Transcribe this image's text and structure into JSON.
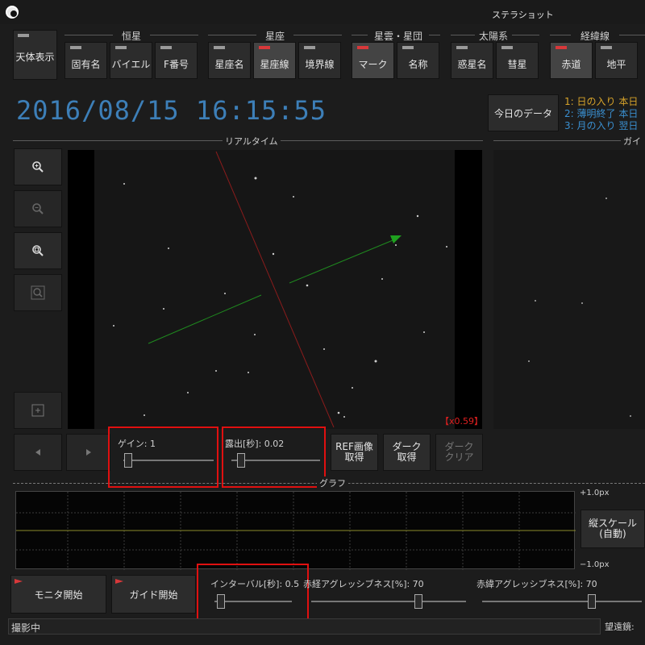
{
  "app": {
    "title": "ステラショット"
  },
  "toolbar": {
    "celestial_display": "天体表示",
    "groups": [
      {
        "label": "恒星",
        "buttons": [
          {
            "label": "固有名",
            "on": false
          },
          {
            "label": "バイエル",
            "on": false
          },
          {
            "label": "F番号",
            "on": false
          }
        ]
      },
      {
        "label": "星座",
        "buttons": [
          {
            "label": "星座名",
            "on": false
          },
          {
            "label": "星座線",
            "on": true
          },
          {
            "label": "境界線",
            "on": false
          }
        ]
      },
      {
        "label": "星雲・星団",
        "buttons": [
          {
            "label": "マーク",
            "on": true
          },
          {
            "label": "名称",
            "on": false
          }
        ]
      },
      {
        "label": "太陽系",
        "buttons": [
          {
            "label": "惑星名",
            "on": false
          },
          {
            "label": "彗星",
            "on": false
          }
        ]
      },
      {
        "label": "経緯線",
        "buttons": [
          {
            "label": "赤道",
            "on": true
          },
          {
            "label": "地平",
            "on": false
          }
        ]
      }
    ]
  },
  "datetime": "2016/08/15 16:15:55",
  "today_button": "今日のデータ",
  "today_info": [
    {
      "num": "1:",
      "text": "日の入り 本日",
      "color": "#d7a32a"
    },
    {
      "num": "2:",
      "text": "薄明終了 本日",
      "color": "#3a8fd0"
    },
    {
      "num": "3:",
      "text": "月の入り 翌日",
      "color": "#3a8fd0"
    }
  ],
  "realtime": {
    "label": "リアルタイム",
    "zoom_readout": "【x0.59】"
  },
  "guide": {
    "label": "ガイド"
  },
  "gain": {
    "label": "ゲイン: 1",
    "value": 1
  },
  "exposure": {
    "label": "露出[秒]: 0.02",
    "value": 0.02
  },
  "capture_buttons": {
    "ref": "REF画像\n取得",
    "dark": "ダーク\n取得",
    "dark_clear": "ダーク\nクリア"
  },
  "graph": {
    "label": "グラフ",
    "top_label": "+1.0px",
    "bottom_label": "−1.0px",
    "scale_button": "縦スケール\n(自動)"
  },
  "controls": {
    "monitor_start": "モニタ開始",
    "guide_start": "ガイド開始",
    "interval": {
      "label": "インターバル[秒]: 0.5",
      "value": 0.5
    },
    "ra_aggr": {
      "label": "赤経アグレッシブネス[%]: 70",
      "value": 70
    },
    "dec_aggr": {
      "label": "赤緯アグレッシブネス[%]: 70",
      "value": 70
    }
  },
  "status": {
    "text": "撮影中",
    "telescope_label": "望遠鏡:"
  }
}
